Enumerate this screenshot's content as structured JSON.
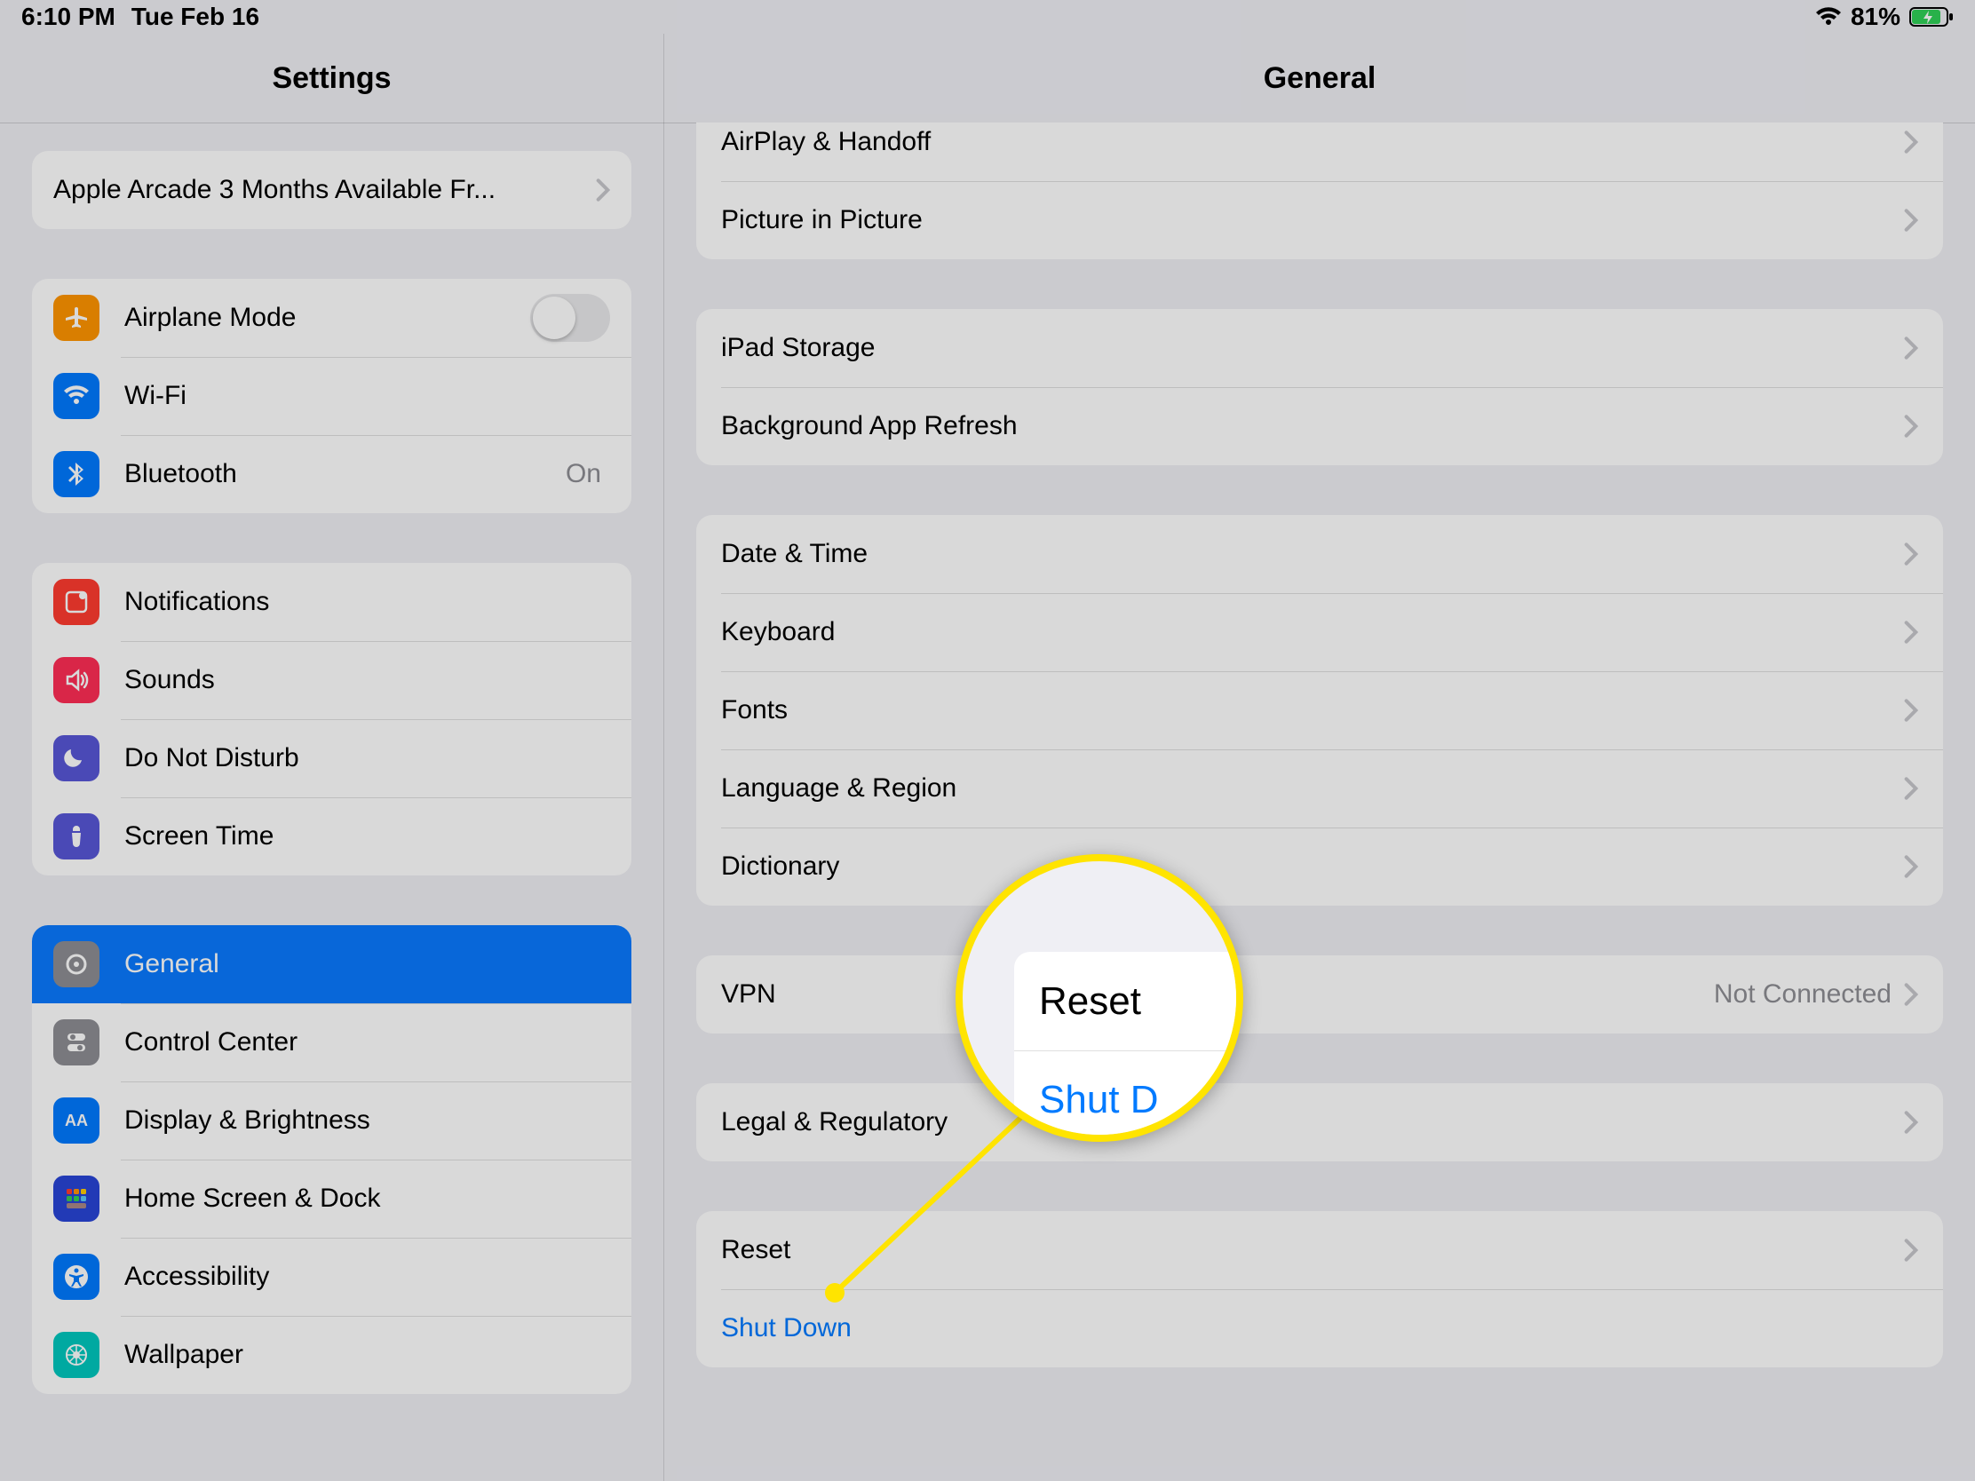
{
  "status": {
    "time": "6:10 PM",
    "date": "Tue Feb 16",
    "battery": "81%"
  },
  "header": {
    "left_title": "Settings",
    "right_title": "General"
  },
  "sidebar": {
    "promo": "Apple Arcade 3 Months Available Fr...",
    "airplane": "Airplane Mode",
    "wifi": "Wi-Fi",
    "bluetooth": "Bluetooth",
    "bluetooth_value": "On",
    "notifications": "Notifications",
    "sounds": "Sounds",
    "dnd": "Do Not Disturb",
    "screentime": "Screen Time",
    "general": "General",
    "controlcenter": "Control Center",
    "display": "Display & Brightness",
    "homescreen": "Home Screen & Dock",
    "accessibility": "Accessibility",
    "wallpaper": "Wallpaper"
  },
  "detail": {
    "airplay": "AirPlay & Handoff",
    "pip": "Picture in Picture",
    "storage": "iPad Storage",
    "bgrefresh": "Background App Refresh",
    "datetime": "Date & Time",
    "keyboard": "Keyboard",
    "fonts": "Fonts",
    "langregion": "Language & Region",
    "dictionary": "Dictionary",
    "vpn": "VPN",
    "vpn_value": "Not Connected",
    "legal": "Legal & Regulatory",
    "reset": "Reset",
    "shutdown": "Shut Down"
  },
  "magnifier": {
    "reset": "Reset",
    "shutdown": "Shut D"
  }
}
